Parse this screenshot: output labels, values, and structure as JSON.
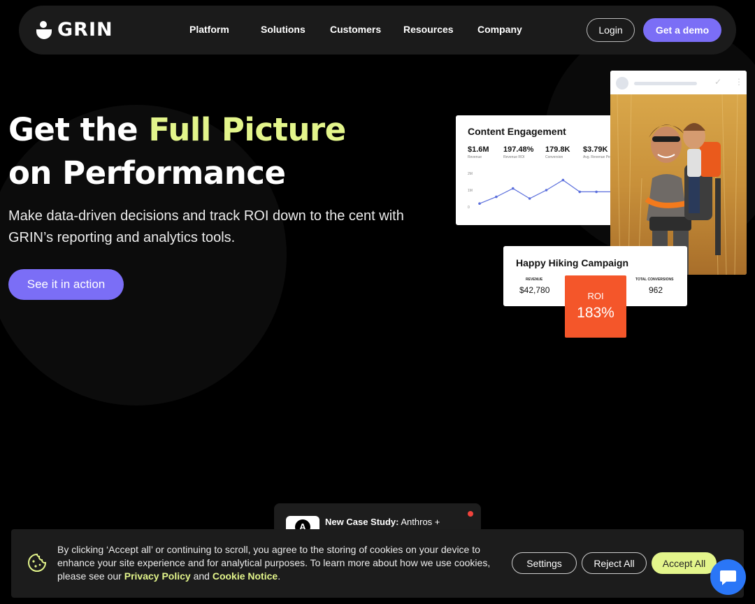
{
  "nav": {
    "logo_text": "GRIN",
    "links": [
      "Platform",
      "Solutions",
      "Customers",
      "Resources",
      "Company"
    ],
    "login_label": "Login",
    "demo_label": "Get a demo"
  },
  "hero": {
    "title_prefix": "Get the ",
    "title_accent": "Full Picture",
    "title_line2": "on Performance",
    "subtitle": "Make data-driven decisions and track ROI down to the cent with GRIN’s reporting and analytics tools.",
    "cta_label": "See it in action"
  },
  "engagement_card": {
    "title": "Content Engagement",
    "stats": [
      {
        "value": "$1.6M",
        "caption": "Revenue"
      },
      {
        "value": "197.48%",
        "caption": "Revenue ROI"
      },
      {
        "value": "179.8K",
        "caption": "Conversion"
      },
      {
        "value": "$3.79K",
        "caption": "Avg. Revenue Per"
      }
    ],
    "y_ticks": [
      "2M",
      "1M",
      "0"
    ],
    "series": [
      0.1,
      0.3,
      0.55,
      0.25,
      0.5,
      0.8,
      0.45,
      0.45,
      0.45
    ]
  },
  "campaign_card": {
    "title": "Happy Hiking Campaign",
    "revenue_label": "REVENUE",
    "revenue_value": "$42,780",
    "conversions_label": "TOTAL CONVERSIONS",
    "conversions_value": "962",
    "roi_label": "ROI",
    "roi_value": "183%"
  },
  "toast": {
    "prefix": "New Case Study:",
    "text": " Anthros +",
    "logo_letter": "A"
  },
  "cookie": {
    "text_before": "By clicking ‘Accept all’ or continuing to scroll, you agree to the storing of cookies on your device to enhance your site experience and for analytical purposes. To learn more about how we use cookies, please see our ",
    "privacy_label": "Privacy Policy",
    "and_text": " and ",
    "cookie_notice_label": "Cookie Notice",
    "end_text": ".",
    "settings_label": "Settings",
    "reject_label": "Reject All",
    "accept_label": "Accept All"
  },
  "colors": {
    "accent_purple": "#7b6ef6",
    "accent_lime": "#e3f58b",
    "roi_orange": "#f4562a",
    "chat_blue": "#2a76f7"
  }
}
